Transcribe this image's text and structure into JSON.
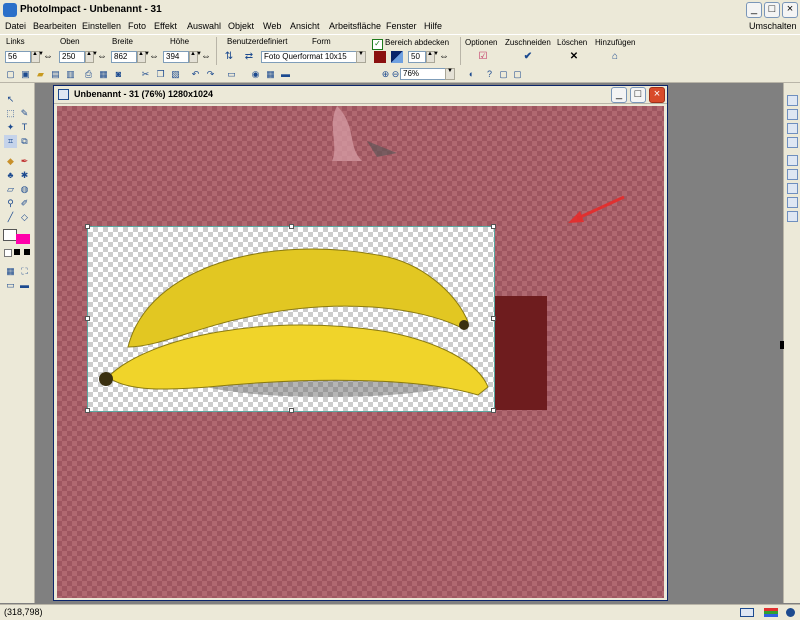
{
  "window": {
    "title": "PhotoImpact - Unbenannt - 31"
  },
  "menu": [
    "Datei",
    "Bearbeiten",
    "Einstellen",
    "Foto",
    "Effekt",
    "Auswahl",
    "Objekt",
    "Web",
    "Ansicht",
    "Arbeitsfläche",
    "Fenster",
    "Hilfe"
  ],
  "menu_right": "Umschalten",
  "attr": {
    "links_label": "Links",
    "links_value": "56",
    "oben_label": "Oben",
    "oben_value": "250",
    "breite_label": "Breite",
    "breite_value": "862",
    "hoehe_label": "Höhe",
    "hoehe_value": "394",
    "benutzer_label": "Benutzerdefiniert",
    "form_label": "Form",
    "form_value": "Foto Querformat 10x15",
    "bereich_label": "Bereich abdecken",
    "bereich_checked": true,
    "opacity_value": "50",
    "optionen_label": "Optionen",
    "zuschneiden_label": "Zuschneiden",
    "loeschen_label": "Löschen",
    "hinzufuegen_label": "Hinzufügen"
  },
  "toolbar": {
    "zoom_value": "76%"
  },
  "document": {
    "title": "Unbenannt - 31 (76%) 1280x1024"
  },
  "colors": {
    "foreground": "#ffffff",
    "background": "#ff00aa",
    "mask": "#b06870",
    "accent_red": "#e03030"
  },
  "status": {
    "coords": "(318,798)"
  }
}
